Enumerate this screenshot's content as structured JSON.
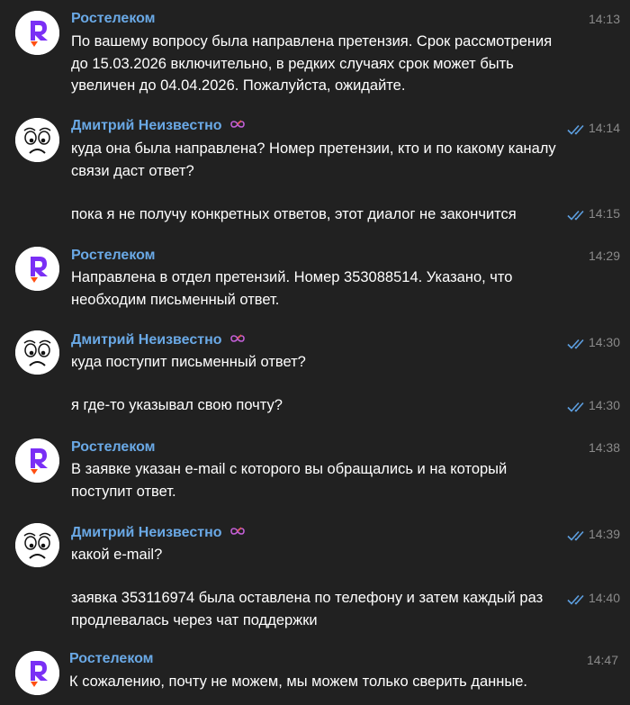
{
  "colors": {
    "background": "#212121",
    "name": "#6aa9e6",
    "time": "#8a8a8a",
    "check": "#5d9fe0",
    "rostelecom_purple": "#7a2ff5",
    "rostelecom_orange": "#ff4f12"
  },
  "messages": [
    {
      "sender": "Ростелеком",
      "avatar": "rostelecom-logo",
      "time": "14:13",
      "read": false,
      "lines": [
        "По вашему вопросу была направлена претензия. Срок рассмотрения до 15.03.2026 включительно, в редких случаях срок может быть увеличен до 04.04.2026. Пожалуйста, ожидайте."
      ]
    },
    {
      "sender": "Дмитрий Неизвестно",
      "avatar": "sad-face",
      "time": "14:14",
      "read": true,
      "lines": [
        "куда она была направлена? Номер претензии, кто и по какому каналу связи даст ответ?"
      ]
    },
    {
      "time": "14:15",
      "read": true,
      "lines": [
        "пока я не получу конкретных ответов, этот диалог не закончится"
      ]
    },
    {
      "sender": "Ростелеком",
      "avatar": "rostelecom-logo",
      "time": "14:29",
      "read": false,
      "lines": [
        "Направлена в отдел претензий. Номер 353088514. Указано, что необходим письменный ответ."
      ]
    },
    {
      "sender": "Дмитрий Неизвестно",
      "avatar": "sad-face",
      "time": "14:30",
      "read": true,
      "lines": [
        "куда поступит письменный ответ?"
      ]
    },
    {
      "time": "14:30",
      "read": true,
      "lines": [
        "я где-то указывал свою почту?"
      ]
    },
    {
      "sender": "Ростелеком",
      "avatar": "rostelecom-logo",
      "time": "14:38",
      "read": false,
      "lines": [
        "В заявке указан e-mail с которого вы обращались и на который поступит ответ."
      ]
    },
    {
      "sender": "Дмитрий Неизвестно",
      "avatar": "sad-face",
      "time": "14:39",
      "read": true,
      "lines": [
        "какой e-mail?"
      ]
    },
    {
      "time": "14:40",
      "read": true,
      "lines": [
        "заявка 353116974 была оставлена по телефону и затем каждый раз продлевалась через чат поддержки"
      ]
    },
    {
      "sender": "Ростелеком",
      "avatar": "rostelecom-logo",
      "time": "14:47",
      "read": false,
      "lines": [
        "К сожалению, почту не можем, мы можем только сверить данные."
      ]
    }
  ]
}
